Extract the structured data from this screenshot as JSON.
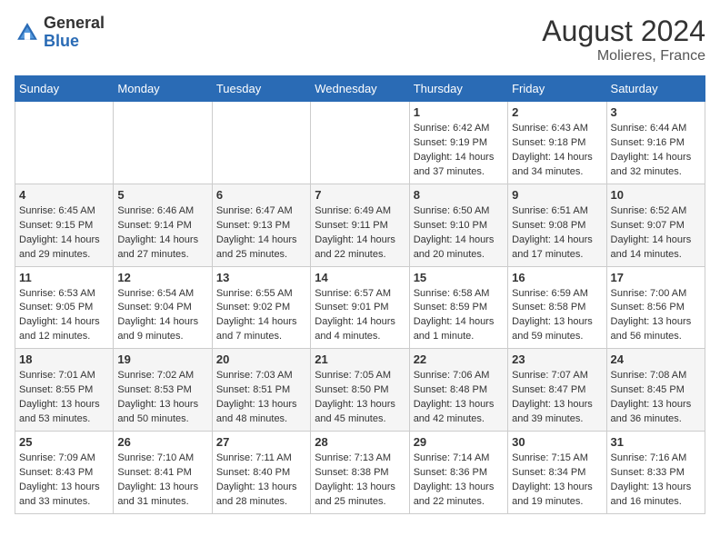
{
  "header": {
    "logo_general": "General",
    "logo_blue": "Blue",
    "month_year": "August 2024",
    "location": "Molieres, France"
  },
  "weekdays": [
    "Sunday",
    "Monday",
    "Tuesday",
    "Wednesday",
    "Thursday",
    "Friday",
    "Saturday"
  ],
  "weeks": [
    [
      {
        "day": "",
        "info": ""
      },
      {
        "day": "",
        "info": ""
      },
      {
        "day": "",
        "info": ""
      },
      {
        "day": "",
        "info": ""
      },
      {
        "day": "1",
        "info": "Sunrise: 6:42 AM\nSunset: 9:19 PM\nDaylight: 14 hours\nand 37 minutes."
      },
      {
        "day": "2",
        "info": "Sunrise: 6:43 AM\nSunset: 9:18 PM\nDaylight: 14 hours\nand 34 minutes."
      },
      {
        "day": "3",
        "info": "Sunrise: 6:44 AM\nSunset: 9:16 PM\nDaylight: 14 hours\nand 32 minutes."
      }
    ],
    [
      {
        "day": "4",
        "info": "Sunrise: 6:45 AM\nSunset: 9:15 PM\nDaylight: 14 hours\nand 29 minutes."
      },
      {
        "day": "5",
        "info": "Sunrise: 6:46 AM\nSunset: 9:14 PM\nDaylight: 14 hours\nand 27 minutes."
      },
      {
        "day": "6",
        "info": "Sunrise: 6:47 AM\nSunset: 9:13 PM\nDaylight: 14 hours\nand 25 minutes."
      },
      {
        "day": "7",
        "info": "Sunrise: 6:49 AM\nSunset: 9:11 PM\nDaylight: 14 hours\nand 22 minutes."
      },
      {
        "day": "8",
        "info": "Sunrise: 6:50 AM\nSunset: 9:10 PM\nDaylight: 14 hours\nand 20 minutes."
      },
      {
        "day": "9",
        "info": "Sunrise: 6:51 AM\nSunset: 9:08 PM\nDaylight: 14 hours\nand 17 minutes."
      },
      {
        "day": "10",
        "info": "Sunrise: 6:52 AM\nSunset: 9:07 PM\nDaylight: 14 hours\nand 14 minutes."
      }
    ],
    [
      {
        "day": "11",
        "info": "Sunrise: 6:53 AM\nSunset: 9:05 PM\nDaylight: 14 hours\nand 12 minutes."
      },
      {
        "day": "12",
        "info": "Sunrise: 6:54 AM\nSunset: 9:04 PM\nDaylight: 14 hours\nand 9 minutes."
      },
      {
        "day": "13",
        "info": "Sunrise: 6:55 AM\nSunset: 9:02 PM\nDaylight: 14 hours\nand 7 minutes."
      },
      {
        "day": "14",
        "info": "Sunrise: 6:57 AM\nSunset: 9:01 PM\nDaylight: 14 hours\nand 4 minutes."
      },
      {
        "day": "15",
        "info": "Sunrise: 6:58 AM\nSunset: 8:59 PM\nDaylight: 14 hours\nand 1 minute."
      },
      {
        "day": "16",
        "info": "Sunrise: 6:59 AM\nSunset: 8:58 PM\nDaylight: 13 hours\nand 59 minutes."
      },
      {
        "day": "17",
        "info": "Sunrise: 7:00 AM\nSunset: 8:56 PM\nDaylight: 13 hours\nand 56 minutes."
      }
    ],
    [
      {
        "day": "18",
        "info": "Sunrise: 7:01 AM\nSunset: 8:55 PM\nDaylight: 13 hours\nand 53 minutes."
      },
      {
        "day": "19",
        "info": "Sunrise: 7:02 AM\nSunset: 8:53 PM\nDaylight: 13 hours\nand 50 minutes."
      },
      {
        "day": "20",
        "info": "Sunrise: 7:03 AM\nSunset: 8:51 PM\nDaylight: 13 hours\nand 48 minutes."
      },
      {
        "day": "21",
        "info": "Sunrise: 7:05 AM\nSunset: 8:50 PM\nDaylight: 13 hours\nand 45 minutes."
      },
      {
        "day": "22",
        "info": "Sunrise: 7:06 AM\nSunset: 8:48 PM\nDaylight: 13 hours\nand 42 minutes."
      },
      {
        "day": "23",
        "info": "Sunrise: 7:07 AM\nSunset: 8:47 PM\nDaylight: 13 hours\nand 39 minutes."
      },
      {
        "day": "24",
        "info": "Sunrise: 7:08 AM\nSunset: 8:45 PM\nDaylight: 13 hours\nand 36 minutes."
      }
    ],
    [
      {
        "day": "25",
        "info": "Sunrise: 7:09 AM\nSunset: 8:43 PM\nDaylight: 13 hours\nand 33 minutes."
      },
      {
        "day": "26",
        "info": "Sunrise: 7:10 AM\nSunset: 8:41 PM\nDaylight: 13 hours\nand 31 minutes."
      },
      {
        "day": "27",
        "info": "Sunrise: 7:11 AM\nSunset: 8:40 PM\nDaylight: 13 hours\nand 28 minutes."
      },
      {
        "day": "28",
        "info": "Sunrise: 7:13 AM\nSunset: 8:38 PM\nDaylight: 13 hours\nand 25 minutes."
      },
      {
        "day": "29",
        "info": "Sunrise: 7:14 AM\nSunset: 8:36 PM\nDaylight: 13 hours\nand 22 minutes."
      },
      {
        "day": "30",
        "info": "Sunrise: 7:15 AM\nSunset: 8:34 PM\nDaylight: 13 hours\nand 19 minutes."
      },
      {
        "day": "31",
        "info": "Sunrise: 7:16 AM\nSunset: 8:33 PM\nDaylight: 13 hours\nand 16 minutes."
      }
    ]
  ]
}
